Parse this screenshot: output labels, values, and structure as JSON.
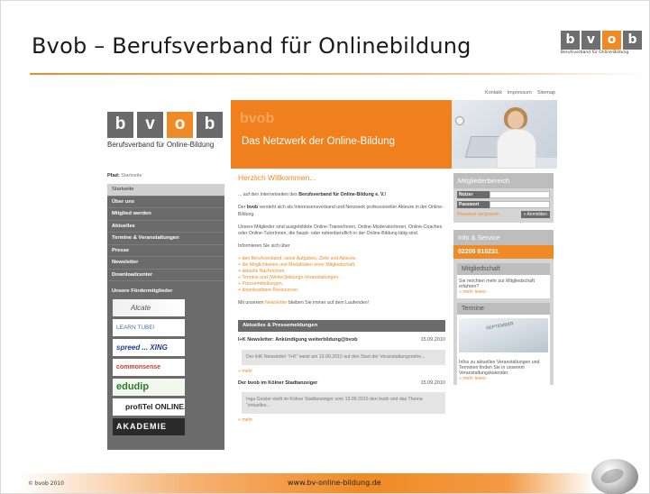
{
  "slide": {
    "title": "Bvob – Berufsverband für Onlinebildung",
    "logo_letters": [
      "b",
      "v",
      "o",
      "b"
    ],
    "logo_caption": "Berufsverband für Online-Bildung",
    "footer_copyright": "© bvob 2010",
    "footer_url": "www.bv-online-bildung.de"
  },
  "site": {
    "top_nav": [
      "Kontakt",
      "Impressum",
      "Sitemap"
    ],
    "brand_letters": [
      "b",
      "v",
      "o",
      "b"
    ],
    "brand_caption": "Berufsverband für Online-Bildung",
    "banner_watermark": "bvob",
    "banner_text": "Das Netzwerk der Online-Bildung",
    "breadcrumb_label": "Pfad:",
    "breadcrumb_value": "Startseite",
    "nav": [
      {
        "label": "Startseite",
        "active": true
      },
      {
        "label": "Über uns"
      },
      {
        "label": "Mitglied werden"
      },
      {
        "label": "Aktuelles"
      },
      {
        "label": "Termine & Veranstaltungen"
      },
      {
        "label": "Presse"
      },
      {
        "label": "Newsletter"
      },
      {
        "label": "Downloadcenter"
      }
    ],
    "members_heading": "Unsere Fördermitglieder",
    "member_logos": [
      "Alcate",
      "LEARN TUBE!",
      "spreed ... XING",
      "commonsense",
      "edudip",
      "profiTel ONLINE.de",
      "AKADEMIE"
    ],
    "main": {
      "welcome": "Herzlich Willkommen...",
      "intro_pre": "... auf den Internetseiten des",
      "intro_bold": "Berufsverband für Online-Bildung e. V.!",
      "para1_pre": "Der",
      "para1_bold": "bvob",
      "para1_post": "versteht sich als Interessensverband und Netzwerk professioneller Akteure in der Online-Bildung.",
      "para2": "Unsere Mitglieder sind ausgebildete Online-TrainerInnen, Online-ModeratorInnen, Online-Coaches oder Online-TutorInnen, die haupt- oder nebenberuflich in der Online-Bildung tätig sind.",
      "para3": "Informieren Sie sich über",
      "links": [
        "den Berufsverband, seine Aufgaben, Ziele und Akteure,",
        "die Möglichkeiten und Modalitäten einer Mitgliedschaft,",
        "aktuelle Nachrichten,",
        "Termine und (Weiter)bildungs-Veranstaltungen,",
        "Pressemitteilungen,",
        "downloadbare Ressourcen."
      ],
      "para4_pre": "Mit unserem",
      "para4_link": "Newsletter",
      "para4_post": "bleiben Sie immer auf dem Laufenden!",
      "news_heading": "Aktuelles & Pressemeldungen",
      "news": [
        {
          "title": "I+K Newsletter: Ankündigung weiterbildung@bvob",
          "date": "15.09.2010",
          "excerpt": "Der IHK Newsletter \"I+K\" weist am 13.09.2010 auf den Start der Veranstaltungsreihe...",
          "more": "» mehr"
        },
        {
          "title": "Der bvob im Kölner Stadtanzeiger",
          "date": "15.09.2010",
          "excerpt": "Inga Geisler stellt im Kölner Stadtanzeiger vom 13.09.2010 den bvob und das Thema \"virtuelles...",
          "more": "» mehr"
        }
      ]
    },
    "right": {
      "members_area": "Mitgliederbereich",
      "user_label": "Nutzer",
      "password_label": "Passwort",
      "forgot": "Passwort vergessen",
      "login_button": "» Anmelden",
      "info_heading": "Info & Service",
      "phone": "02206 910231",
      "membership_heading": "Mitgliedschaft",
      "membership_text": "Sie möchten mehr zur Mitgliedschaft erfahren?",
      "membership_more": "» mehr lesen",
      "events_heading": "Termine",
      "events_text": "Infos zu aktuellen Veranstaltungen und Terminen finden Sie in unserem Veranstaltungskalender.",
      "events_more": "» mehr lesen",
      "calendar_word": "SEPTEMBER"
    }
  },
  "colors": {
    "accent_orange": "#f08a24",
    "nav_gray": "#6b6b6b",
    "panel_gray": "#d4d4d4"
  }
}
